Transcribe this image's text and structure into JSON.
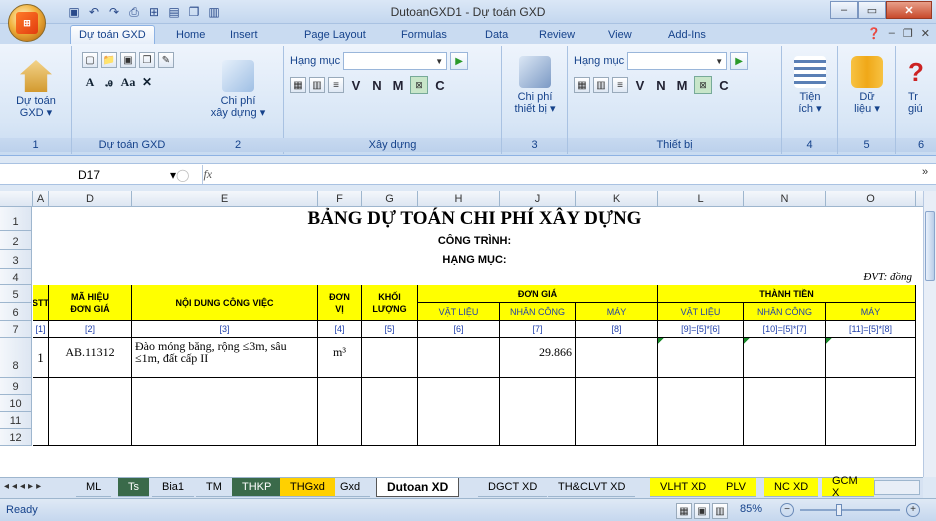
{
  "window": {
    "title": "DutoanGXD1 - Dự toán GXD"
  },
  "qat": [
    "save-icon",
    "undo-icon",
    "redo-icon",
    "print-preview-icon",
    "insert-icon",
    "table-icon",
    "copy-icon",
    "paste-icon"
  ],
  "tabs": [
    "Dự toán GXD",
    "Home",
    "Insert",
    "Page Layout",
    "Formulas",
    "Data",
    "Review",
    "View",
    "Add-Ins"
  ],
  "ribbon": {
    "g1": {
      "btn": "Dự toán\nGXD ▾",
      "label": "1"
    },
    "g2": {
      "big": "Chi phí\nxây dựng ▾",
      "label": "Dự toán GXD",
      "num": "2"
    },
    "g3": {
      "combo_label": "Hạng mục",
      "label": "Xây dựng",
      "letters": [
        "V",
        "N",
        "M",
        "C"
      ]
    },
    "g4": {
      "big": "Chi phí\nthiết bị ▾",
      "num": "3"
    },
    "g5": {
      "combo_label": "Hạng mục",
      "label": "Thiết bị",
      "letters": [
        "V",
        "N",
        "M",
        "C"
      ]
    },
    "g6": {
      "big": "Tiện\ních ▾",
      "num": "4"
    },
    "g7": {
      "big": "Dữ\nliệu ▾",
      "num": "5"
    },
    "g8": {
      "big": "Tr\ngiú",
      "num": "6"
    }
  },
  "formula_bar": {
    "cell": "D17",
    "fx": "fx"
  },
  "columns": [
    "A",
    "D",
    "E",
    "F",
    "G",
    "H",
    "J",
    "K",
    "L",
    "N",
    "O"
  ],
  "rows": [
    "1",
    "2",
    "3",
    "4",
    "5",
    "6",
    "7",
    "8",
    "9",
    "10",
    "11",
    "12"
  ],
  "sheet": {
    "title": "BẢNG DỰ TOÁN CHI PHÍ XÂY DỰNG",
    "cong_trinh": "CÔNG TRÌNH:",
    "hang_muc": "HẠNG MỤC:",
    "dvt": "ĐVT: đồng",
    "headers": {
      "stt": "STT",
      "ma": "MÃ HIỆU\nĐƠN GIÁ",
      "noidung": "NỘI DUNG CÔNG VIỆC",
      "donvi": "ĐƠN\nVỊ",
      "khoi": "KHỐI\nLƯỢNG",
      "dongia": "ĐƠN GIÁ",
      "thanhtien": "THÀNH TIỀN",
      "vl": "VẬT LIỆU",
      "nc": "NHÂN CÔNG",
      "may": "MÁY",
      "vl2": "VẬT LIỆU",
      "nc2": "NHÂN CÔNG",
      "may2": "MÁY"
    },
    "index_row": [
      "[1]",
      "[2]",
      "[3]",
      "[4]",
      "[5]",
      "[6]",
      "[7]",
      "[8]",
      "[9]=[5]*[6]",
      "[10]=[5]*[7]",
      "[11]=[5]*[8]"
    ],
    "data_row": {
      "stt": "1",
      "ma": "AB.11312",
      "noidung": "Đào móng băng, rộng ≤3m, sâu ≤1m, đất cấp II",
      "donvi": "m³",
      "nc": "29.866"
    }
  },
  "sheet_tabs": [
    "ML",
    "Ts",
    "Bia1",
    "TM",
    "THKP",
    "THGxd",
    "Gxd",
    "Dutoan XD",
    "DGCT XD",
    "TH&CLVT XD",
    "VLHT XD",
    "PLV",
    "NC XD",
    "GCM X"
  ],
  "status": {
    "ready": "Ready",
    "zoom": "85%"
  }
}
